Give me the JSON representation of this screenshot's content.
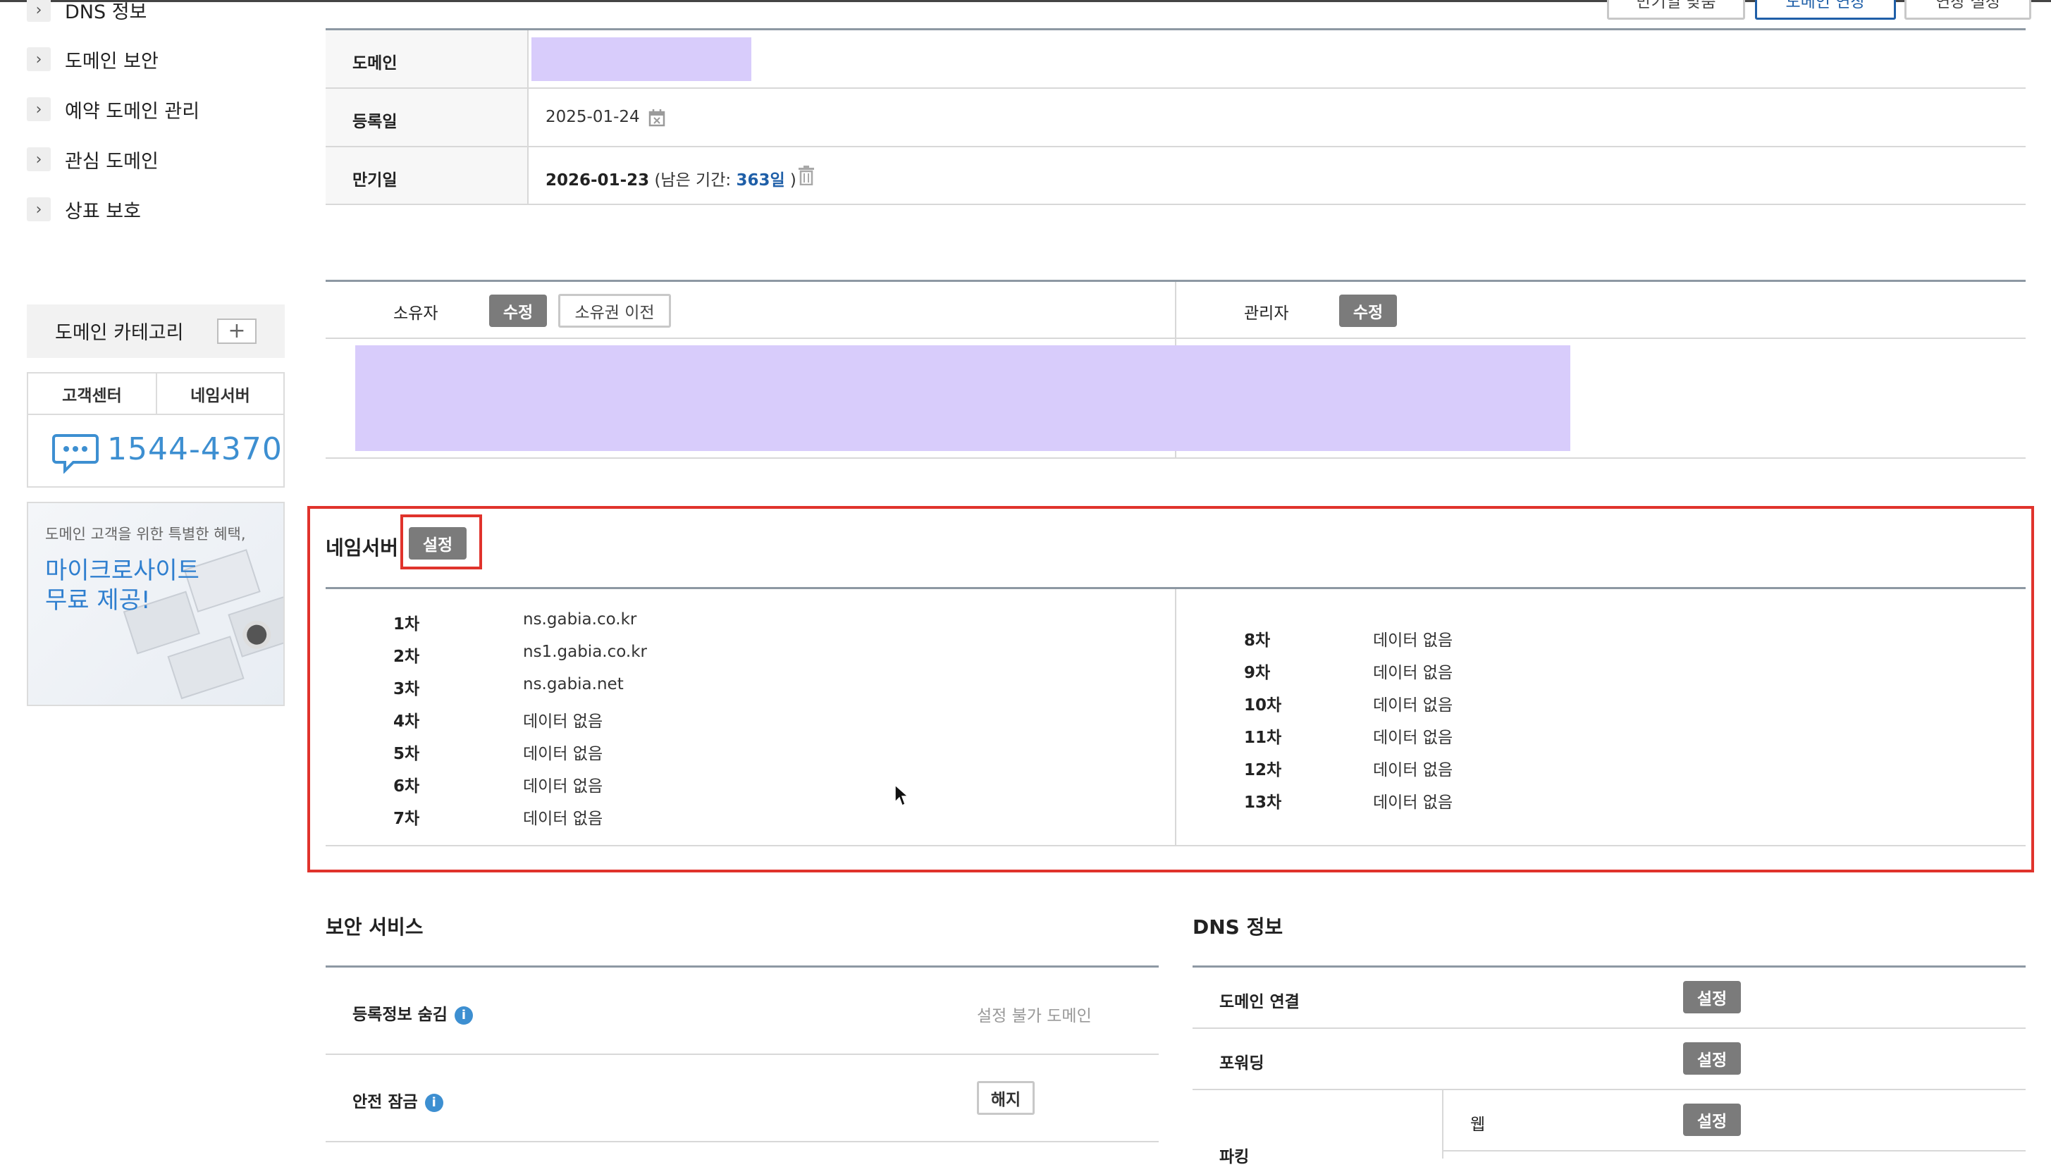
{
  "sidebar": {
    "items": [
      {
        "label": "DNS 정보"
      },
      {
        "label": "도메인 보안"
      },
      {
        "label": "예약 도메인 관리"
      },
      {
        "label": "관심 도메인"
      },
      {
        "label": "상표 보호"
      }
    ],
    "category": {
      "label": "도메인 카테고리",
      "add_icon": "+"
    },
    "support": {
      "tabs": [
        "고객센터",
        "네임서버"
      ],
      "phone": "1544-4370"
    },
    "promo": {
      "line1": "도메인 고객을 위한 특별한 혜택,",
      "line2": "마이크로사이트",
      "line3": "무료 제공!"
    }
  },
  "top_buttons": [
    "만기일 맞춤",
    "도메인 연장",
    "연장 설정"
  ],
  "domain_info": {
    "domain_label": "도메인",
    "registered_label": "등록일",
    "registered_value": "2025-01-24",
    "expiry_label": "만기일",
    "expiry_date": "2026-01-23",
    "remaining_prefix": "(남은 기간:",
    "remaining_days": "363일",
    "remaining_suffix": ")"
  },
  "contacts": {
    "owner_label": "소유자",
    "owner_edit": "수정",
    "owner_transfer": "소유권 이전",
    "admin_label": "관리자",
    "admin_edit": "수정"
  },
  "nameserver": {
    "title": "네임서버",
    "setting_button": "설정",
    "left": [
      {
        "rank": "1차",
        "value": "ns.gabia.co.kr"
      },
      {
        "rank": "2차",
        "value": "ns1.gabia.co.kr"
      },
      {
        "rank": "3차",
        "value": "ns.gabia.net"
      },
      {
        "rank": "4차",
        "value": "데이터 없음"
      },
      {
        "rank": "5차",
        "value": "데이터 없음"
      },
      {
        "rank": "6차",
        "value": "데이터 없음"
      },
      {
        "rank": "7차",
        "value": "데이터 없음"
      }
    ],
    "right": [
      {
        "rank": "8차",
        "value": "데이터 없음"
      },
      {
        "rank": "9차",
        "value": "데이터 없음"
      },
      {
        "rank": "10차",
        "value": "데이터 없음"
      },
      {
        "rank": "11차",
        "value": "데이터 없음"
      },
      {
        "rank": "12차",
        "value": "데이터 없음"
      },
      {
        "rank": "13차",
        "value": "데이터 없음"
      }
    ]
  },
  "security": {
    "title": "보안 서비스",
    "rows": [
      {
        "label": "등록정보 숨김",
        "value": "설정 불가 도메인"
      },
      {
        "label": "안전 잠금",
        "button": "해지"
      }
    ]
  },
  "dns": {
    "title": "DNS 정보",
    "rows": [
      {
        "label": "도메인 연결",
        "button": "설정"
      },
      {
        "label": "포워딩",
        "button": "설정"
      },
      {
        "label": "파킹",
        "sub_label": "웹",
        "button": "설정"
      }
    ]
  },
  "colors": {
    "highlight_border": "#e0332c",
    "redaction": "#d8ccfb",
    "accent_blue": "#1f5fa8",
    "button_gray": "#7b7b7b",
    "phone_blue": "#3d8fd1"
  }
}
